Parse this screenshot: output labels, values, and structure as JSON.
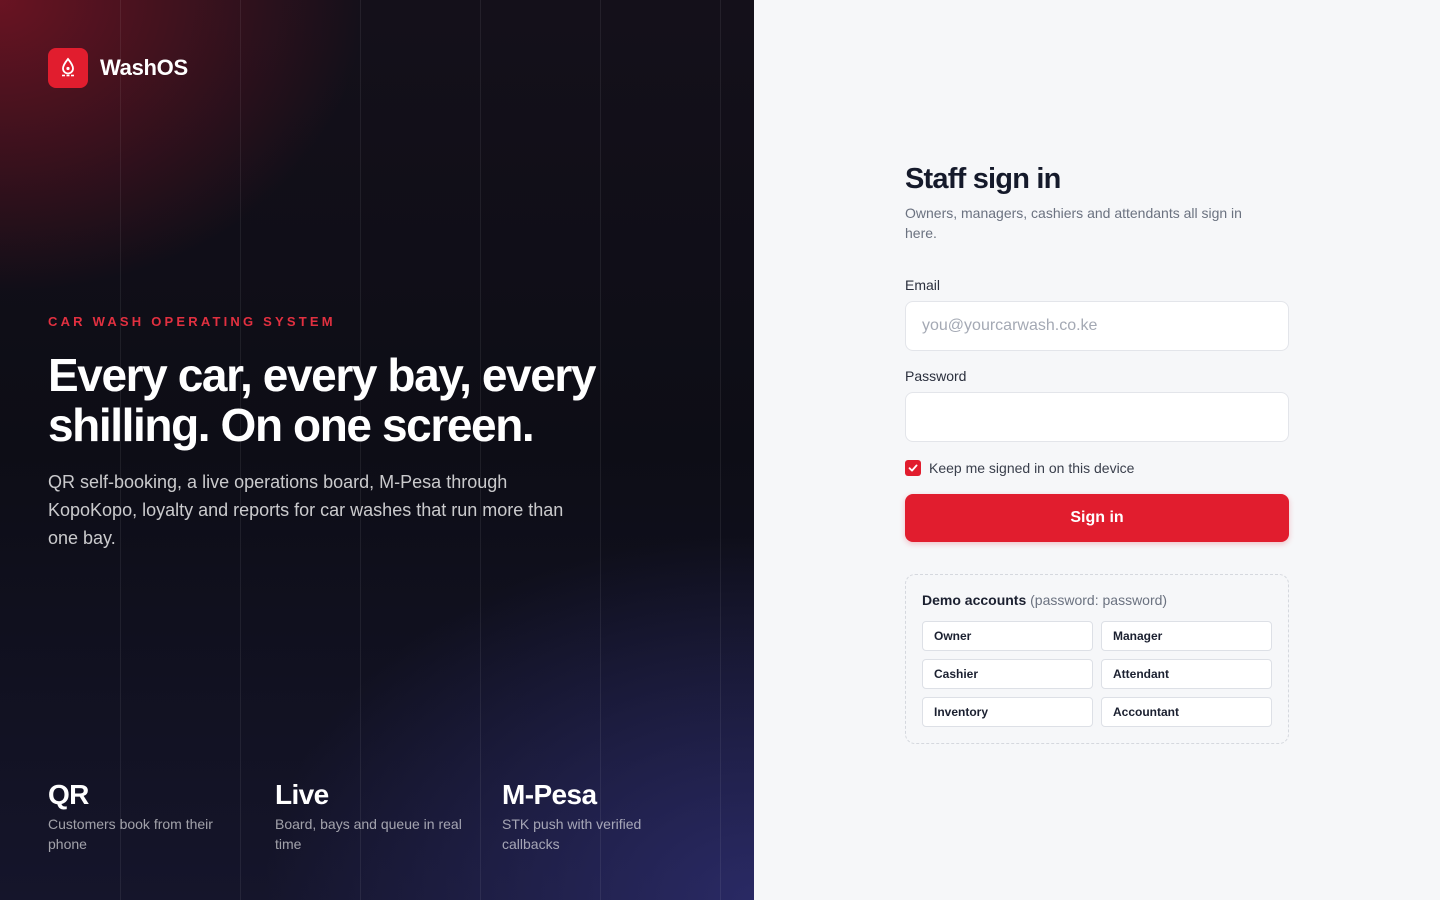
{
  "brand": {
    "name": "WashOS",
    "icon": "droplet-icon",
    "accent": "#e11d2e"
  },
  "hero": {
    "eyebrow": "CAR WASH OPERATING SYSTEM",
    "headline": "Every car, every bay, every shilling. On one screen.",
    "lede": "QR self-booking, a live operations board, M-Pesa through KopoKopo, loyalty and reports for car washes that run more than one bay.",
    "features": [
      {
        "title": "QR",
        "desc": "Customers book from their phone"
      },
      {
        "title": "Live",
        "desc": "Board, bays and queue in real time"
      },
      {
        "title": "M-Pesa",
        "desc": "STK push with verified callbacks"
      }
    ]
  },
  "form": {
    "title": "Staff sign in",
    "subtitle": "Owners, managers, cashiers and attendants all sign in here.",
    "email_label": "Email",
    "email_placeholder": "you@yourcarwash.co.ke",
    "email_value": "",
    "password_label": "Password",
    "password_value": "",
    "remember_label": "Keep me signed in on this device",
    "remember_checked": true,
    "submit_label": "Sign in"
  },
  "demo": {
    "title": "Demo accounts",
    "hint": "(password: password)",
    "accounts": [
      "Owner",
      "Manager",
      "Cashier",
      "Attendant",
      "Inventory",
      "Accountant"
    ]
  },
  "colors": {
    "accent": "#e11d2e",
    "panel_bg": "#f6f7f9",
    "hero_bg": "#0d0d16"
  }
}
